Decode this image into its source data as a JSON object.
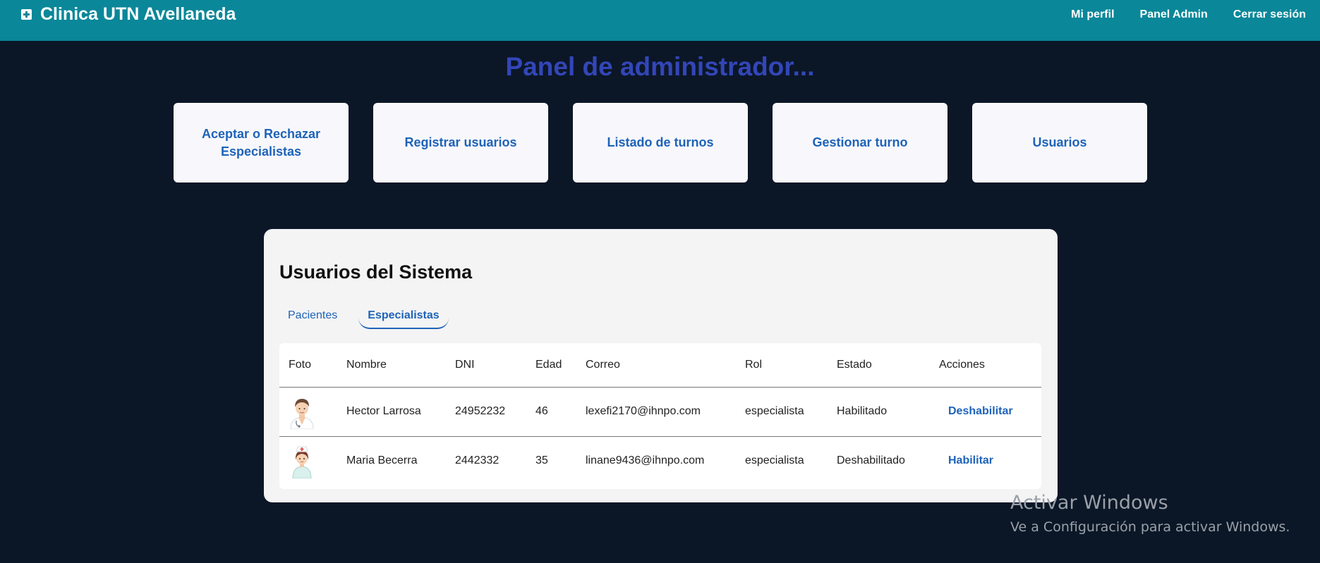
{
  "app": {
    "title": "Clinica UTN Avellaneda"
  },
  "nav": [
    {
      "label": "Mi perfil"
    },
    {
      "label": "Panel Admin"
    },
    {
      "label": "Cerrar sesión"
    }
  ],
  "page": {
    "title": "Panel de administrador..."
  },
  "cards": [
    {
      "label": "Aceptar o Rechazar Especialistas"
    },
    {
      "label": "Registrar usuarios"
    },
    {
      "label": "Listado de turnos"
    },
    {
      "label": "Gestionar turno"
    },
    {
      "label": "Usuarios"
    }
  ],
  "users": {
    "title": "Usuarios del Sistema",
    "tabs": [
      {
        "label": "Pacientes",
        "active": false
      },
      {
        "label": "Especialistas",
        "active": true
      }
    ],
    "columns": [
      "Foto",
      "Nombre",
      "DNI",
      "Edad",
      "Correo",
      "Rol",
      "Estado",
      "Acciones"
    ],
    "rows": [
      {
        "avatar": "male-doctor-avatar",
        "nombre": "Hector Larrosa",
        "dni": "24952232",
        "edad": "46",
        "correo": "lexefi2170@ihnpo.com",
        "rol": "especialista",
        "estado": "Habilitado",
        "accion": "Deshabilitar"
      },
      {
        "avatar": "female-nurse-avatar",
        "nombre": "Maria Becerra",
        "dni": "2442332",
        "edad": "35",
        "correo": "linane9436@ihnpo.com",
        "rol": "especialista",
        "estado": "Deshabilitado",
        "accion": "Habilitar"
      }
    ]
  },
  "watermark": {
    "line1": "Activar Windows",
    "line2": "Ve a Configuración para activar Windows."
  },
  "colors": {
    "background": "#0b1727",
    "topbar": "#0a8799",
    "title": "#3346b8",
    "accent": "#1e63b8"
  }
}
